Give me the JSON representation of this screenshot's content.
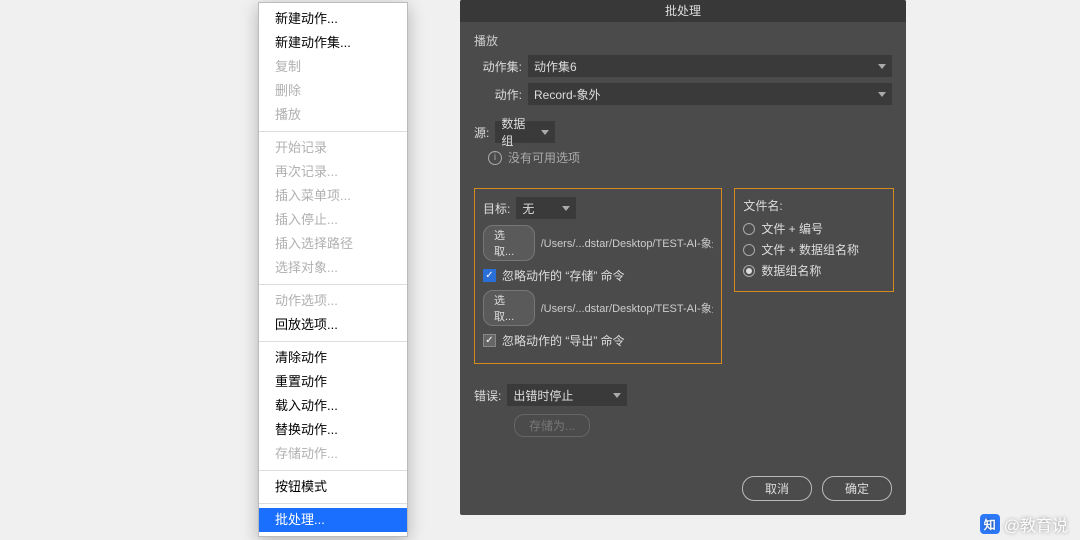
{
  "context_menu": {
    "groups": [
      [
        {
          "label": "新建动作...",
          "enabled": true
        },
        {
          "label": "新建动作集...",
          "enabled": true
        },
        {
          "label": "复制",
          "enabled": false
        },
        {
          "label": "删除",
          "enabled": false
        },
        {
          "label": "播放",
          "enabled": false
        }
      ],
      [
        {
          "label": "开始记录",
          "enabled": false
        },
        {
          "label": "再次记录...",
          "enabled": false
        },
        {
          "label": "插入菜单项...",
          "enabled": false
        },
        {
          "label": "插入停止...",
          "enabled": false
        },
        {
          "label": "插入选择路径",
          "enabled": false
        },
        {
          "label": "选择对象...",
          "enabled": false
        }
      ],
      [
        {
          "label": "动作选项...",
          "enabled": false
        },
        {
          "label": "回放选项...",
          "enabled": true
        }
      ],
      [
        {
          "label": "清除动作",
          "enabled": true
        },
        {
          "label": "重置动作",
          "enabled": true
        },
        {
          "label": "载入动作...",
          "enabled": true
        },
        {
          "label": "替换动作...",
          "enabled": true
        },
        {
          "label": "存储动作...",
          "enabled": false
        }
      ],
      [
        {
          "label": "按钮模式",
          "enabled": true
        }
      ],
      [
        {
          "label": "批处理...",
          "enabled": true,
          "selected": true
        }
      ]
    ]
  },
  "dialog": {
    "title": "批处理",
    "play": {
      "section": "播放",
      "set_label": "动作集:",
      "set_value": "动作集6",
      "action_label": "动作:",
      "action_value": "Record-象外"
    },
    "source": {
      "label": "源:",
      "value": "数据组",
      "no_options": "没有可用选项"
    },
    "dest": {
      "label": "目标:",
      "value": "无",
      "choose": "选取...",
      "path": "/Users/...dstar/Desktop/TEST-AI-象外",
      "override_save": "忽略动作的 “存储” 命令",
      "override_export": "忽略动作的 “导出” 命令"
    },
    "filename": {
      "label": "文件名:",
      "options": [
        "文件 + 编号",
        "文件 + 数据组名称",
        "数据组名称"
      ],
      "selected": 2
    },
    "error": {
      "label": "错误:",
      "value": "出错时停止",
      "save_as": "存储为..."
    },
    "buttons": {
      "cancel": "取消",
      "ok": "确定"
    }
  },
  "watermark": "@教育说"
}
